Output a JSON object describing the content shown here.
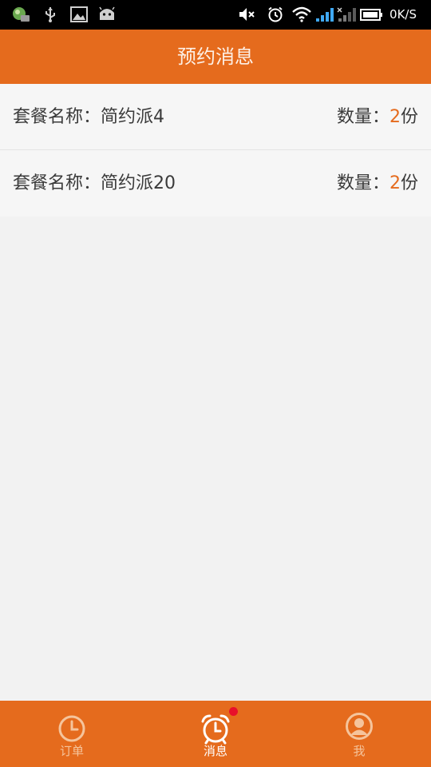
{
  "status_bar": {
    "network_speed": "0K/S",
    "icons": [
      "notification-app-icon",
      "usb-icon",
      "image-icon",
      "android-icon",
      "mute-icon",
      "alarm-icon",
      "wifi-icon",
      "signal-icon",
      "signal-icon",
      "battery-icon"
    ]
  },
  "header": {
    "title": "预约消息"
  },
  "messages": [
    {
      "package_prefix": "套餐名称：",
      "package_name": "简约派4",
      "quantity_prefix": "数量：",
      "quantity": "2",
      "quantity_unit": "份"
    },
    {
      "package_prefix": "套餐名称：",
      "package_name": "简约派20",
      "quantity_prefix": "数量：",
      "quantity": "2",
      "quantity_unit": "份"
    }
  ],
  "tab_bar": {
    "tabs": [
      {
        "label": "订单",
        "icon": "clock-icon",
        "active": false
      },
      {
        "label": "消息",
        "icon": "alarm-clock-icon",
        "active": true,
        "badge": true
      },
      {
        "label": "我",
        "icon": "user-icon",
        "active": false
      }
    ]
  },
  "colors": {
    "accent": "#e56b1d",
    "badge": "#e8102a",
    "background": "#f2f2f2"
  }
}
